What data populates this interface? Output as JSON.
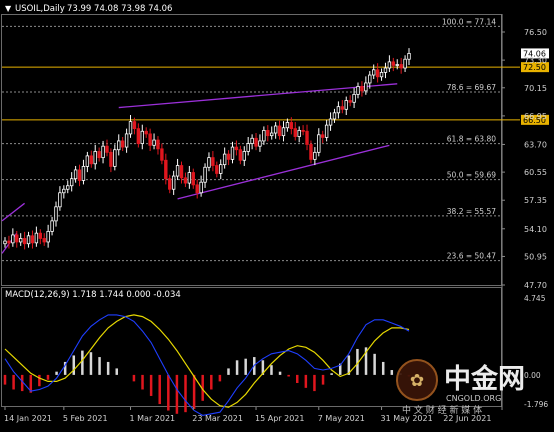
{
  "chart_data": {
    "type": "candlestick",
    "symbol_label": "USOIL,Daily",
    "ohlc_label": "73.99 74.08 73.98 74.06",
    "price_axis_ticks": [
      "76.50",
      "73.30",
      "70.15",
      "66.95",
      "63.70",
      "60.55",
      "57.35",
      "54.10",
      "50.95",
      "47.70"
    ],
    "price_range": [
      47.7,
      79.5
    ],
    "date_ticks": [
      {
        "label": "14 Jan 2021",
        "bar": 0
      },
      {
        "label": "5 Feb 2021",
        "bar": 15
      },
      {
        "label": "1 Mar 2021",
        "bar": 32
      },
      {
        "label": "23 Mar 2021",
        "bar": 48
      },
      {
        "label": "15 Apr 2021",
        "bar": 64
      },
      {
        "label": "7 May 2021",
        "bar": 80
      },
      {
        "label": "31 May 2021",
        "bar": 96
      },
      {
        "label": "22 Jun 2021",
        "bar": 112
      }
    ],
    "fib_levels": [
      {
        "label": "100.0 = 77.14",
        "price": 77.14
      },
      {
        "label": "78.6 = 69.67",
        "price": 69.67
      },
      {
        "label": "61.8 = 63.80",
        "price": 63.8
      },
      {
        "label": "50.0 = 59.69",
        "price": 59.69
      },
      {
        "label": "38.2 = 55.57",
        "price": 55.57
      },
      {
        "label": "23.6 = 50.47",
        "price": 50.47
      }
    ],
    "horizontal_lines": [
      {
        "label": "72.50",
        "price": 72.5
      },
      {
        "label": "66.50",
        "price": 66.5
      }
    ],
    "current_price": {
      "label": "74.06",
      "price": 74.06
    },
    "closes": [
      52.7,
      52.5,
      53.4,
      52.6,
      53.0,
      52.4,
      53.3,
      52.5,
      53.6,
      53.0,
      52.6,
      53.8,
      55.0,
      56.6,
      58.2,
      58.6,
      59.0,
      59.8,
      60.8,
      59.6,
      61.2,
      62.4,
      61.5,
      62.9,
      62.2,
      63.5,
      62.8,
      61.2,
      63.1,
      64.1,
      63.4,
      64.9,
      66.3,
      65.5,
      63.8,
      65.2,
      64.9,
      63.6,
      64.2,
      63.2,
      61.9,
      59.8,
      58.6,
      60.1,
      61.3,
      59.9,
      59.3,
      60.5,
      59.1,
      58.2,
      59.4,
      61.1,
      62.2,
      61.3,
      60.4,
      61.4,
      62.6,
      62.0,
      63.4,
      63.1,
      61.9,
      62.9,
      63.8,
      64.4,
      63.5,
      64.1,
      65.3,
      64.7,
      65.0,
      65.8,
      64.7,
      65.6,
      66.2,
      65.5,
      64.6,
      65.3,
      65.2,
      63.7,
      62.0,
      62.8,
      64.8,
      64.5,
      65.9,
      66.6,
      67.3,
      68.0,
      67.7,
      68.7,
      68.5,
      69.4,
      70.3,
      69.8,
      70.7,
      71.6,
      72.2,
      71.4,
      71.9,
      72.4,
      73.1,
      72.7,
      72.8,
      72.4,
      73.4,
      74.06
    ],
    "macd": {
      "label": "MACD(12,26,9) 1.718 1.744 0.000 -0.034",
      "scale_labels": [
        "4.745",
        "0.00",
        "-1.796"
      ],
      "signal": [
        1.6,
        1.1,
        0.6,
        0.1,
        -0.2,
        -0.4,
        -0.4,
        -0.2,
        0.3,
        0.9,
        1.6,
        2.3,
        2.9,
        3.3,
        3.6,
        3.7,
        3.6,
        3.3,
        2.8,
        2.2,
        1.5,
        0.7,
        -0.1,
        -0.9,
        -1.5,
        -1.9,
        -2.0,
        -1.7,
        -1.2,
        -0.5,
        0.1,
        0.7,
        1.2,
        1.6,
        1.8,
        1.7,
        1.4,
        0.9,
        0.3,
        -0.1,
        0.1,
        0.7,
        1.4,
        2.1,
        2.6,
        2.9,
        2.9,
        2.8
      ],
      "histogram": [
        -0.6,
        -0.9,
        -1.0,
        -1.1,
        -0.7,
        -0.3,
        0.2,
        0.8,
        1.2,
        1.5,
        1.4,
        1.1,
        0.8,
        0.4,
        0.0,
        -0.4,
        -0.9,
        -1.3,
        -1.8,
        -2.2,
        -2.4,
        -2.3,
        -2.1,
        -1.6,
        -0.9,
        -0.4,
        0.4,
        0.9,
        1.0,
        1.1,
        0.9,
        0.6,
        0.2,
        -0.1,
        -0.5,
        -0.8,
        -1.0,
        -0.6,
        0.1,
        0.7,
        1.2,
        1.6,
        1.7,
        1.3,
        0.8,
        0.3,
        0.1,
        -0.1
      ]
    }
  },
  "watermark": {
    "brand_cn": "中金网",
    "site": "CNGOLD.ORG",
    "tagline": "中 文 财 经 新 媒 体"
  },
  "colors": {
    "background": "#000000",
    "bull": "#ffffff",
    "bear": "#e0161e",
    "fib": "#8c8c8c",
    "hline": "#e8b200",
    "channel": "#9b30d9",
    "macd_signal": "#e6d800",
    "macd_main": "#1f3fff",
    "grid_text": "#d0d0d0"
  }
}
